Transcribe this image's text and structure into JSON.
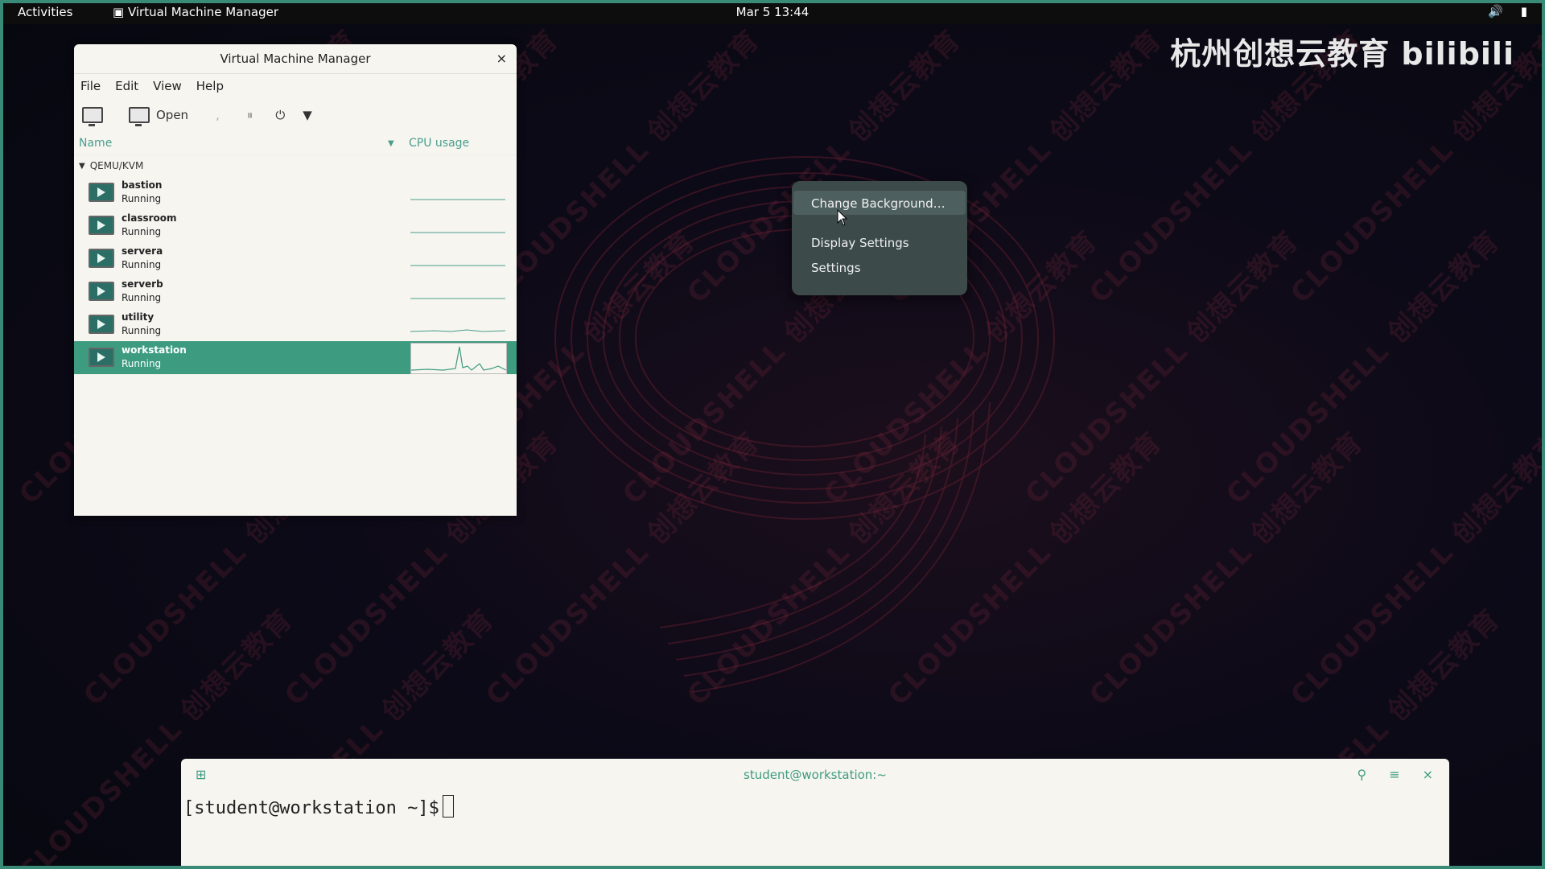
{
  "topbar": {
    "activities": "Activities",
    "app_name": "Virtual Machine Manager",
    "date": "Mar 5",
    "time": "13:44",
    "volume_icon": "speaker-icon",
    "battery_icon": "battery-icon"
  },
  "watermark": {
    "logo_text": "杭州创想云教育 bilibili",
    "tile_text": "CLOUDSHELL 创想云教育"
  },
  "vmm": {
    "title": "Virtual Machine Manager",
    "close": "×",
    "menu": [
      "File",
      "Edit",
      "View",
      "Help"
    ],
    "toolbar": {
      "open_label": "Open",
      "separator_mark": ","
    },
    "columns": {
      "name": "Name",
      "cpu": "CPU usage"
    },
    "group": "QEMU/KVM",
    "vms": [
      {
        "name": "bastion",
        "status": "Running"
      },
      {
        "name": "classroom",
        "status": "Running"
      },
      {
        "name": "servera",
        "status": "Running"
      },
      {
        "name": "serverb",
        "status": "Running"
      },
      {
        "name": "utility",
        "status": "Running"
      },
      {
        "name": "workstation",
        "status": "Running",
        "selected": true
      }
    ],
    "accent_color": "#3d9c80"
  },
  "context_menu": {
    "items": [
      "Change Background…",
      "Display Settings",
      "Settings"
    ]
  },
  "terminal": {
    "title": "student@workstation:~",
    "prompt": "[student@workstation ~]$"
  }
}
